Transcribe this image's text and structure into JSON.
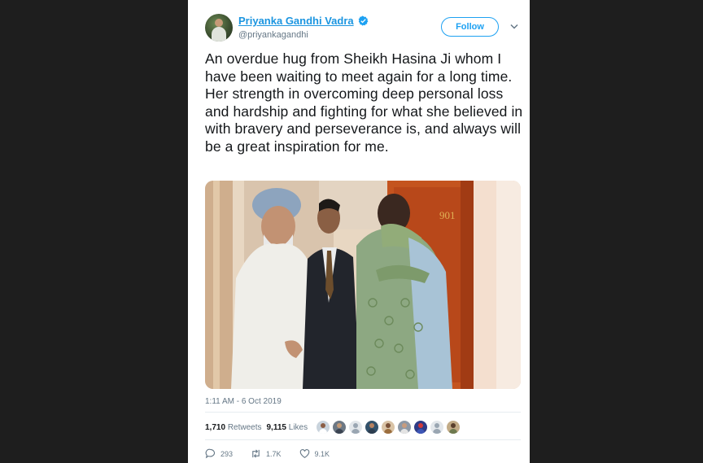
{
  "tweet": {
    "author_name": "Priyanka Gandhi Vadra",
    "author_handle": "@priyankagandhi",
    "follow_label": "Follow",
    "text": "An overdue hug from Sheikh Hasina Ji whom I have been waiting to meet again for a long time. Her strength in overcoming deep personal loss and hardship and fighting for what she believed in with bravery and perseverance is, and always will be a great inspiration for me.",
    "photo": {
      "door_number": "901"
    },
    "timestamp": "1:11 AM - 6 Oct 2019",
    "retweets_count": "1,710",
    "retweets_label": "Retweets",
    "likes_count": "9,115",
    "likes_label": "Likes",
    "liker_avatars": [
      "avatar-1",
      "avatar-2",
      "avatar-3",
      "avatar-4",
      "avatar-5",
      "avatar-6",
      "avatar-7",
      "avatar-8",
      "avatar-9"
    ],
    "reply_count": "293",
    "retweet_count_short": "1.7K",
    "like_count_short": "9.1K"
  },
  "colors": {
    "link_blue": "#1b95e0",
    "follow_blue": "#1da1f2",
    "background": "#1e1e1e",
    "muted_text": "#657786"
  },
  "icons": {
    "verified": "verified-badge-icon",
    "caret": "chevron-down-icon",
    "reply": "reply-icon",
    "retweet": "retweet-icon",
    "like": "heart-icon"
  }
}
